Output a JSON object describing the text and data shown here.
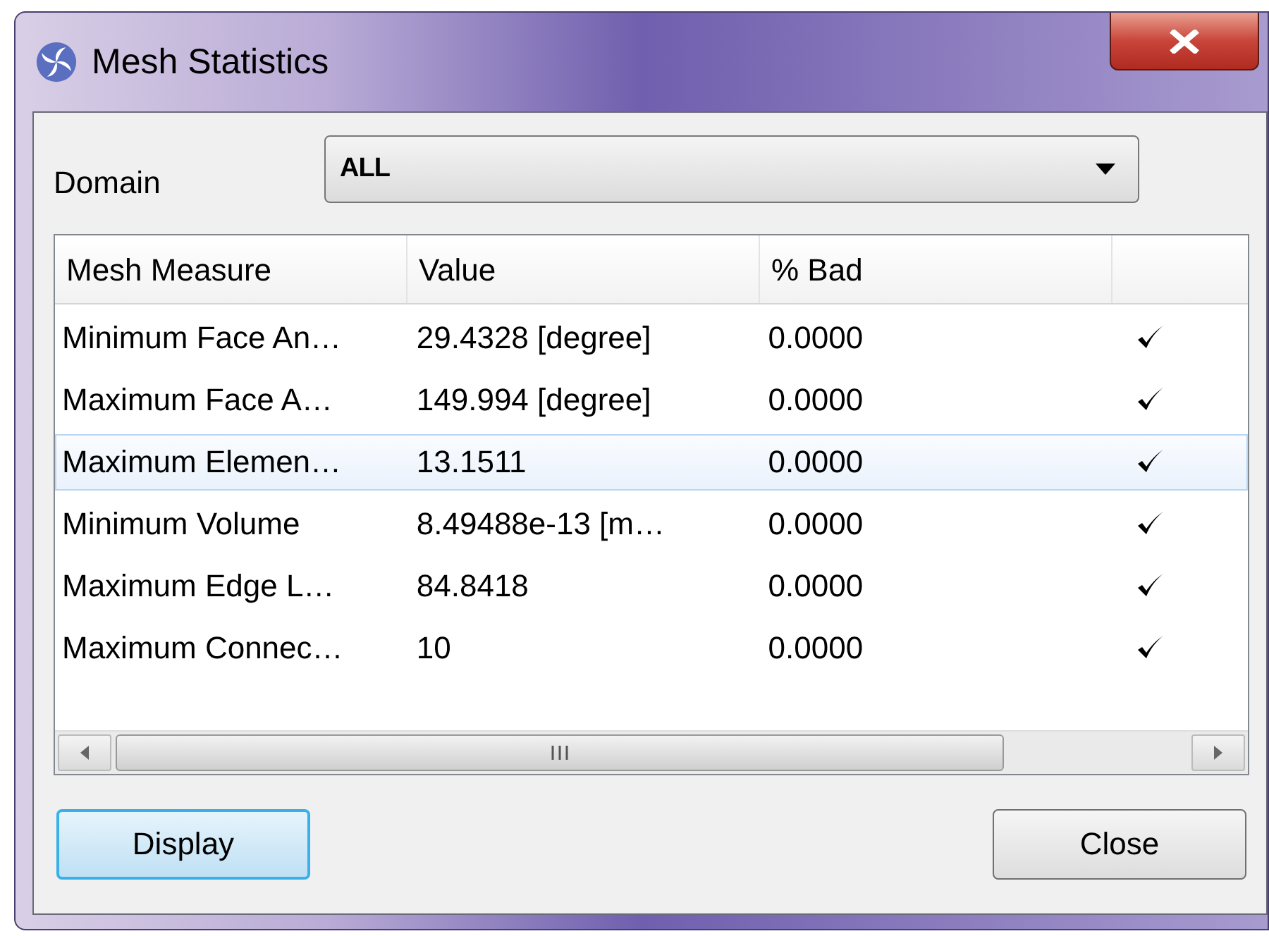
{
  "window": {
    "title": "Mesh Statistics"
  },
  "domain": {
    "label": "Domain",
    "value": "ALL"
  },
  "table": {
    "columns": [
      "Mesh Measure",
      "Value",
      "% Bad"
    ],
    "rows": [
      {
        "measure": "Minimum Face An…",
        "value": "29.4328 [degree]",
        "bad": "0.0000",
        "passed": true,
        "selected": false
      },
      {
        "measure": "Maximum Face A…",
        "value": "149.994 [degree]",
        "bad": "0.0000",
        "passed": true,
        "selected": false
      },
      {
        "measure": "Maximum Elemen…",
        "value": "13.1511",
        "bad": "0.0000",
        "passed": true,
        "selected": true
      },
      {
        "measure": "Minimum Volume",
        "value": "8.49488e-13 [m…",
        "bad": "0.0000",
        "passed": true,
        "selected": false
      },
      {
        "measure": "Maximum Edge L…",
        "value": "84.8418",
        "bad": "0.0000",
        "passed": true,
        "selected": false
      },
      {
        "measure": "Maximum Connec…",
        "value": "10",
        "bad": "0.0000",
        "passed": true,
        "selected": false
      }
    ]
  },
  "buttons": [
    {
      "label": "Display",
      "focused": true
    },
    {
      "label": "Close",
      "focused": false
    }
  ]
}
